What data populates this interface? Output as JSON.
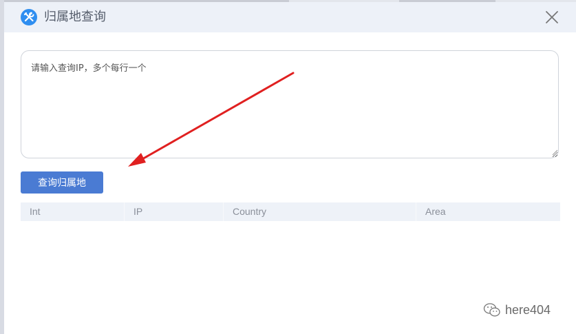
{
  "dialog": {
    "title": "归属地查询",
    "logo_icon": "tools-icon",
    "close_icon": "close-icon"
  },
  "form": {
    "ip_input_placeholder": "请输入查询IP，多个每行一个",
    "ip_input_value": "",
    "submit_label": "查询归属地"
  },
  "results_table": {
    "columns": [
      "Int",
      "IP",
      "Country",
      "Area"
    ],
    "rows": []
  },
  "annotation": {
    "arrow_color": "#e02020"
  },
  "watermark": {
    "icon": "wechat-icon",
    "text": "here404"
  },
  "colors": {
    "header_bg": "#edf1f8",
    "button_bg": "#4a7bd3",
    "logo_bg": "#2f8ef0",
    "table_header_bg": "#eef2f8"
  }
}
